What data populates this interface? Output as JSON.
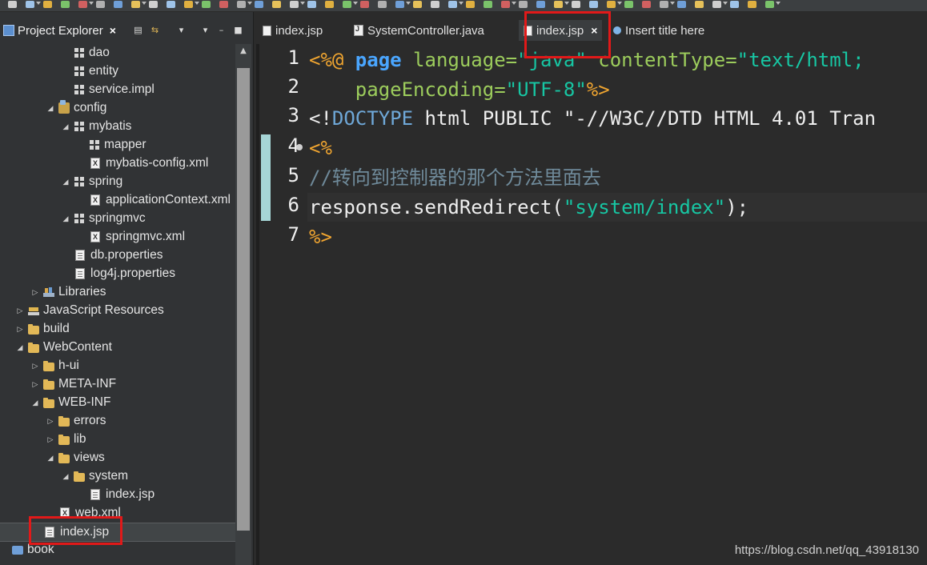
{
  "explorer": {
    "title": "Project Explorer",
    "close_glyph": "×",
    "tree": [
      {
        "label": "dao",
        "icon": "package-icon",
        "twisty": ""
      },
      {
        "label": "entity",
        "icon": "package-icon",
        "twisty": ""
      },
      {
        "label": "service.impl",
        "icon": "package-icon",
        "twisty": ""
      },
      {
        "label": "config",
        "icon": "source-folder-icon",
        "twisty": "expanded"
      },
      {
        "label": "mybatis",
        "icon": "package-icon",
        "twisty": "expanded"
      },
      {
        "label": "mapper",
        "icon": "package-icon",
        "twisty": ""
      },
      {
        "label": "mybatis-config.xml",
        "icon": "xml-file-icon",
        "twisty": ""
      },
      {
        "label": "spring",
        "icon": "package-icon",
        "twisty": "expanded"
      },
      {
        "label": "applicationContext.xml",
        "icon": "xml-file-icon",
        "twisty": ""
      },
      {
        "label": "springmvc",
        "icon": "package-icon",
        "twisty": "expanded"
      },
      {
        "label": "springmvc.xml",
        "icon": "xml-file-icon",
        "twisty": ""
      },
      {
        "label": "db.properties",
        "icon": "file-icon",
        "twisty": ""
      },
      {
        "label": "log4j.properties",
        "icon": "file-icon",
        "twisty": ""
      },
      {
        "label": "Libraries",
        "icon": "library-icon",
        "twisty": "collapsed"
      },
      {
        "label": "JavaScript Resources",
        "icon": "js-resources-icon",
        "twisty": "collapsed"
      },
      {
        "label": "build",
        "icon": "folder-icon",
        "twisty": "collapsed"
      },
      {
        "label": "WebContent",
        "icon": "folder-icon",
        "twisty": "expanded"
      },
      {
        "label": "h-ui",
        "icon": "folder-icon",
        "twisty": "collapsed"
      },
      {
        "label": "META-INF",
        "icon": "folder-icon",
        "twisty": "collapsed"
      },
      {
        "label": "WEB-INF",
        "icon": "folder-icon",
        "twisty": "expanded"
      },
      {
        "label": "errors",
        "icon": "folder-icon",
        "twisty": "collapsed"
      },
      {
        "label": "lib",
        "icon": "folder-icon",
        "twisty": "collapsed"
      },
      {
        "label": "views",
        "icon": "folder-icon",
        "twisty": "expanded"
      },
      {
        "label": "system",
        "icon": "folder-icon",
        "twisty": "expanded"
      },
      {
        "label": "index.jsp",
        "icon": "file-icon",
        "twisty": ""
      },
      {
        "label": "web.xml",
        "icon": "xml-file-icon",
        "twisty": ""
      },
      {
        "label": "index.jsp",
        "icon": "file-icon",
        "twisty": "",
        "selected": true
      },
      {
        "label": "book",
        "icon": "project-icon",
        "twisty": ""
      }
    ]
  },
  "editor": {
    "tabs": [
      {
        "label": "index.jsp",
        "icon": "jsp-file-icon"
      },
      {
        "label": "SystemController.java",
        "icon": "java-file-icon"
      },
      {
        "label": "index.jsp",
        "icon": "jsp-file-icon",
        "active": true
      },
      {
        "label": "Insert title here",
        "icon": "browser-icon"
      }
    ],
    "active_close_glyph": "×",
    "line_numbers": [
      "1",
      "2",
      "3",
      "4",
      "5",
      "6",
      "7"
    ],
    "lines": {
      "l1": {
        "a": "<%@ ",
        "b": "page",
        "c": " language=",
        "d": "\"java\"",
        "e": " contentType=",
        "f": "\"text/html;"
      },
      "l2": {
        "a": "    pageEncoding=",
        "b": "\"UTF-8\"",
        "c": "%>"
      },
      "l3": {
        "a": "<!",
        "b": "DOCTYPE",
        "c": " html PUBLIC \"-//W3C//DTD HTML 4.01 Tran"
      },
      "l4": {
        "a": "<%"
      },
      "l5": {
        "a": "//转向到控制器的那个方法里面去"
      },
      "l6": {
        "a": "response.sendRedirect(",
        "b": "\"system/index\"",
        "c": ");"
      },
      "l7": {
        "a": "%>"
      }
    }
  },
  "watermark": "https://blog.csdn.net/qq_43918130",
  "colors": {
    "highlight_box": "#e11919",
    "editor_bg": "#2b2b2b",
    "jsp_delimiter": "#f0a530",
    "string": "#17c6a3"
  }
}
